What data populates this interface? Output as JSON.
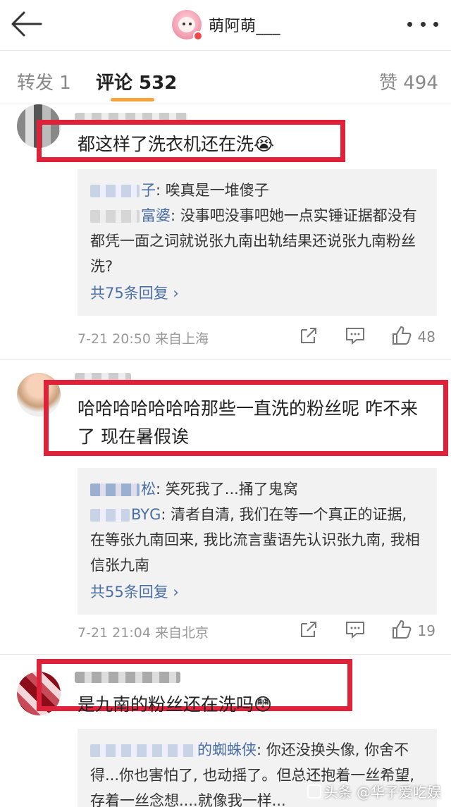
{
  "header": {
    "title": "萌阿萌___",
    "back_icon": "back-arrow-icon",
    "more_icon": "more-dots-icon"
  },
  "tabs": [
    {
      "label": "转发 1"
    },
    {
      "label": "评论 532"
    },
    {
      "label": "赞 494"
    }
  ],
  "accent_color": "#f6a33a",
  "highlight_color": "#e0213a",
  "link_color": "#4a6fa5",
  "comments": [
    {
      "text": "都这样了洗衣机还在洗😭",
      "replies": [
        {
          "author_visible": "子",
          "text": "唉真是一堆傻子"
        },
        {
          "author_visible": "富婆",
          "text": "没事吧没事吧她一点实锤证据都没有都凭一面之词就说张九南出轨结果还说张九南粉丝洗?"
        }
      ],
      "more_replies": "共75条回复 ›",
      "time": "7-21 20:50  来自上海",
      "likes": "48"
    },
    {
      "text": "哈哈哈哈哈哈哈那些一直洗的粉丝呢 咋不来了 现在暑假诶",
      "replies": [
        {
          "author_visible": "松",
          "text": "笑死我了...捅了鬼窝"
        },
        {
          "author_visible": "BYG",
          "text": "清者自清, 我们在等一个真正的证据, 在等张九南回来, 我比流言蜚语先认识张九南, 我相信张九南"
        }
      ],
      "more_replies": "共55条回复 ›",
      "time": "7-21 21:04  来自北京",
      "likes": "19"
    },
    {
      "text": "是九南的粉丝还在洗吗😳",
      "replies": [
        {
          "author_visible": "的蜘蛛侠",
          "text": "你还没换头像, 你舍不得...你也害怕了, 也动摇了。但总还抱着一丝希望, 存着一丝念想....就像我一样..."
        }
      ]
    }
  ],
  "watermark": "头条 @华子爱吃娱"
}
